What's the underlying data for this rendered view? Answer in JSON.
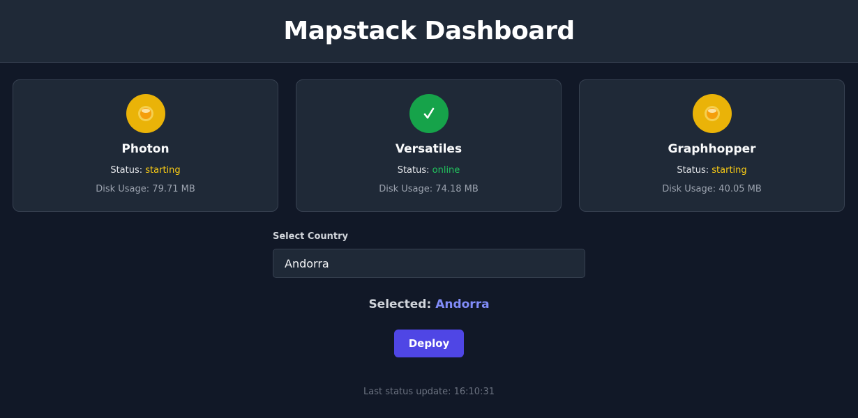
{
  "header": {
    "title": "Mapstack Dashboard"
  },
  "services": [
    {
      "name": "Photon",
      "status_label": "Status:",
      "status": "starting",
      "disk_label": "Disk Usage:",
      "disk": "79.71 MB",
      "icon": "hourglass-icon",
      "color": "#eab308"
    },
    {
      "name": "Versatiles",
      "status_label": "Status:",
      "status": "online",
      "disk_label": "Disk Usage:",
      "disk": "74.18 MB",
      "icon": "check-icon",
      "color": "#16a34a"
    },
    {
      "name": "Graphhopper",
      "status_label": "Status:",
      "status": "starting",
      "disk_label": "Disk Usage:",
      "disk": "40.05 MB",
      "icon": "hourglass-icon",
      "color": "#eab308"
    }
  ],
  "country_select": {
    "label": "Select Country",
    "value": "Andorra"
  },
  "selected": {
    "label": "Selected:",
    "value": "Andorra"
  },
  "deploy_button": {
    "label": "Deploy"
  },
  "footer": {
    "last_update": "Last status update: 16:10:31"
  }
}
